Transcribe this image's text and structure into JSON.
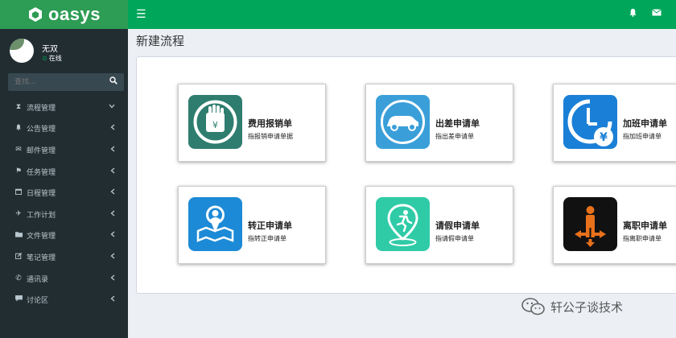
{
  "brand": {
    "name": "oasys"
  },
  "sidebar": {
    "user": {
      "name": "无双",
      "status": "在线"
    },
    "search_placeholder": "查找...",
    "items": [
      {
        "label": "流程管理",
        "icon": "hourglass-icon",
        "expanded": true
      },
      {
        "label": "公告管理",
        "icon": "bell-icon",
        "expanded": false
      },
      {
        "label": "邮件管理",
        "icon": "envelope-icon",
        "expanded": false
      },
      {
        "label": "任务管理",
        "icon": "flag-icon",
        "expanded": false
      },
      {
        "label": "日程管理",
        "icon": "calendar-icon",
        "expanded": false
      },
      {
        "label": "工作计划",
        "icon": "plane-icon",
        "expanded": false
      },
      {
        "label": "文件管理",
        "icon": "folder-icon",
        "expanded": false
      },
      {
        "label": "笔记管理",
        "icon": "edit-icon",
        "expanded": false
      },
      {
        "label": "通讯录",
        "icon": "phone-icon",
        "expanded": false
      },
      {
        "label": "讨论区",
        "icon": "comment-icon",
        "expanded": false
      }
    ]
  },
  "page": {
    "title": "新建流程"
  },
  "cards": [
    {
      "title": "费用报销单",
      "sub": "指报销申请单据",
      "icon": "reimburse-icon",
      "color": "#2e7d6f"
    },
    {
      "title": "出差申请单",
      "sub": "指出差申请单",
      "icon": "car-icon",
      "color": "#3a9fd9"
    },
    {
      "title": "加班申请单",
      "sub": "指加班申请单",
      "icon": "clock-yen-icon",
      "color": "#1a7fd6"
    },
    {
      "title": "转正申请单",
      "sub": "指转正申请单",
      "icon": "person-map-icon",
      "color": "#1c8ad6"
    },
    {
      "title": "请假申请单",
      "sub": "指请假申请单",
      "icon": "runner-pin-icon",
      "color": "#2fcba7"
    },
    {
      "title": "离职申请单",
      "sub": "指离职申请单",
      "icon": "person-arrows-icon",
      "color": "#111111"
    }
  ],
  "watermark": {
    "text": "轩公子谈技术"
  }
}
